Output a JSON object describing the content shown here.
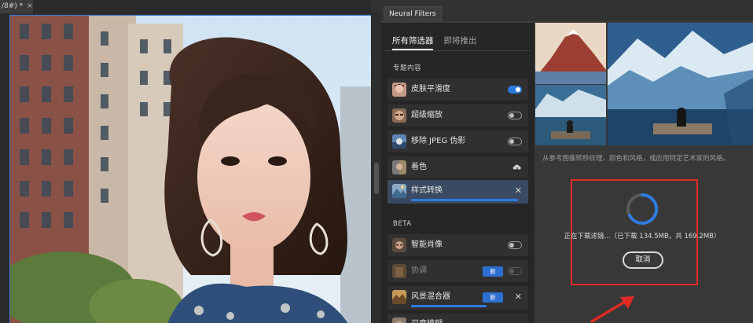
{
  "document": {
    "tab_title": "/8#) *",
    "close_glyph": "×"
  },
  "panel": {
    "title": "Neural Filters"
  },
  "filter_tabs": [
    {
      "label": "所有筛选器",
      "active": true
    },
    {
      "label": "即将推出",
      "active": false
    }
  ],
  "sections": {
    "featured": "专题内容",
    "beta": "BETA"
  },
  "featured_filters": [
    {
      "label": "皮肤平滑度",
      "control": "toggle",
      "state": "on",
      "icon": "face-thumbnail"
    },
    {
      "label": "超级缩放",
      "control": "toggle",
      "state": "off",
      "icon": "zoom-face-thumbnail"
    },
    {
      "label": "移除 JPEG 伪影",
      "control": "toggle",
      "state": "off",
      "icon": "jpeg-thumbnail"
    },
    {
      "label": "着色",
      "control": "cloud-download",
      "icon": "colorize-thumbnail"
    },
    {
      "label": "样式转换",
      "control": "close",
      "selected": true,
      "download_progress": 0.91,
      "icon": "style-transfer-thumbnail"
    }
  ],
  "beta_filters": [
    {
      "label": "智能肖像",
      "control": "toggle",
      "state": "off",
      "icon": "portrait-thumbnail"
    },
    {
      "label": "协调",
      "control": "toggle",
      "state": "off",
      "dim": true,
      "badge": "新",
      "icon": "harmonize-thumbnail"
    },
    {
      "label": "风景混合器",
      "control": "close",
      "badge": "新",
      "download_progress": 0.65,
      "icon": "landscape-thumbnail"
    },
    {
      "label": "深度模糊",
      "control": "",
      "icon": "depth-blur-thumbnail"
    }
  ],
  "preview": {
    "description": "从参考图像转移纹理、颜色和风格，或应用特定艺术家的风格。",
    "download_status": "正在下载滤镜...（已下载 134.5MB，共 169.2MB）",
    "downloaded_mb": 134.5,
    "total_mb": 169.2,
    "cancel_label": "取消"
  },
  "colors": {
    "accent": "#2d7be0",
    "highlight_box": "#e12a25",
    "badge": "#2d6fd1"
  }
}
